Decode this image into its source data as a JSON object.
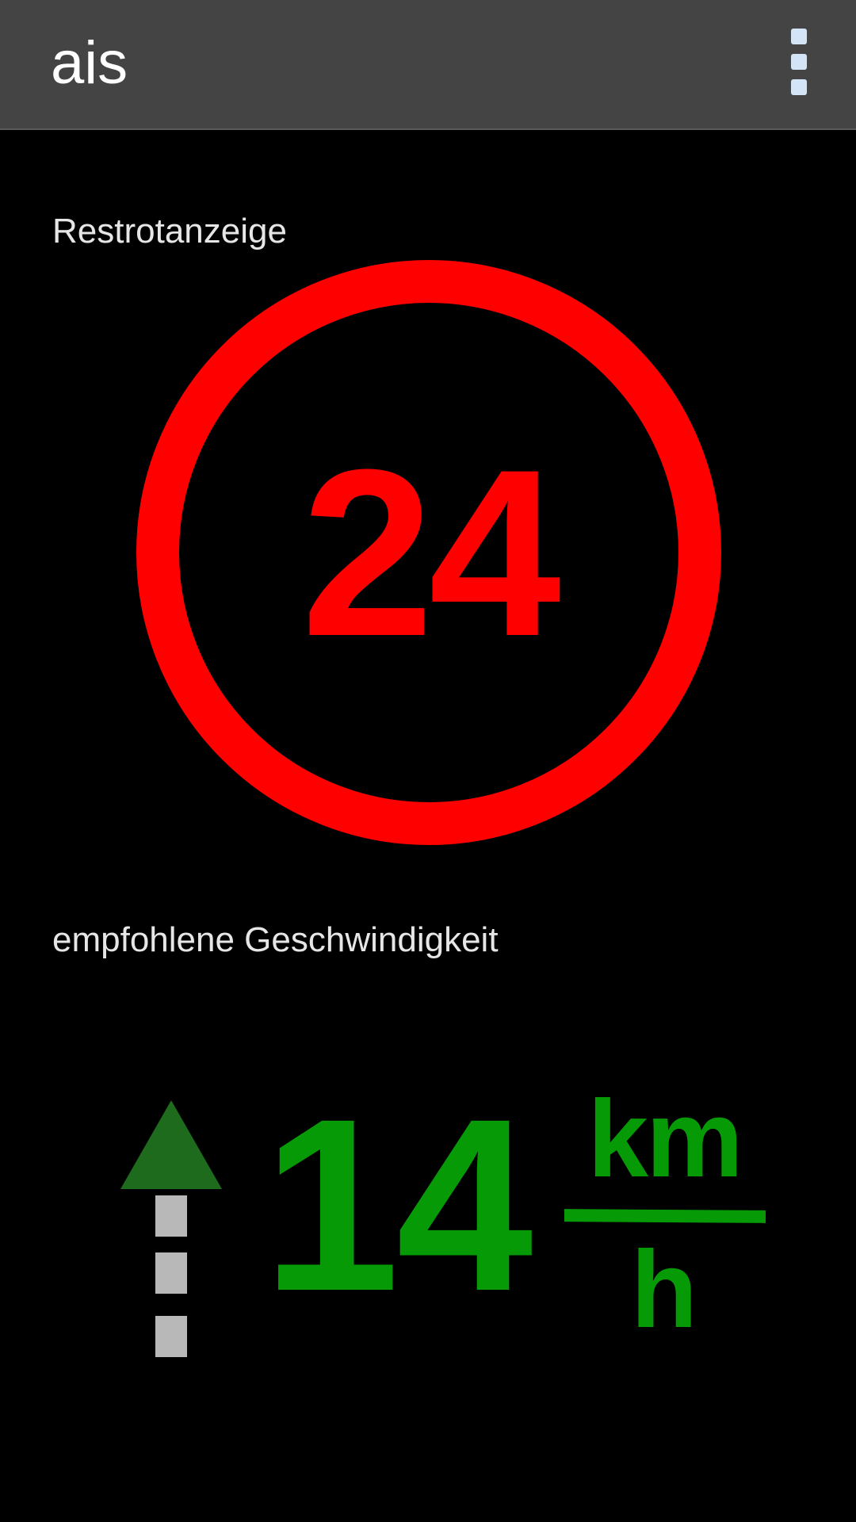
{
  "app_bar": {
    "title": "ais",
    "overflow_menu_icon": "overflow-menu-icon"
  },
  "red_light_timer": {
    "label": "Restrotanzeige",
    "value": "24",
    "color": "#ff0000"
  },
  "speed_recommendation": {
    "label": "empfohlene Geschwindigkeit",
    "value": "14",
    "unit_numerator": "km",
    "unit_denominator": "h",
    "color": "#079a07",
    "direction_icon": "straight-ahead-arrow-icon"
  },
  "colors": {
    "action_bar": "#444444",
    "background": "#000000",
    "label_text": "#e6e6e6",
    "arrow_head": "#1e6b1e",
    "lane_marks": "#b8b8b8",
    "menu_dots": "#d4e4f7"
  }
}
